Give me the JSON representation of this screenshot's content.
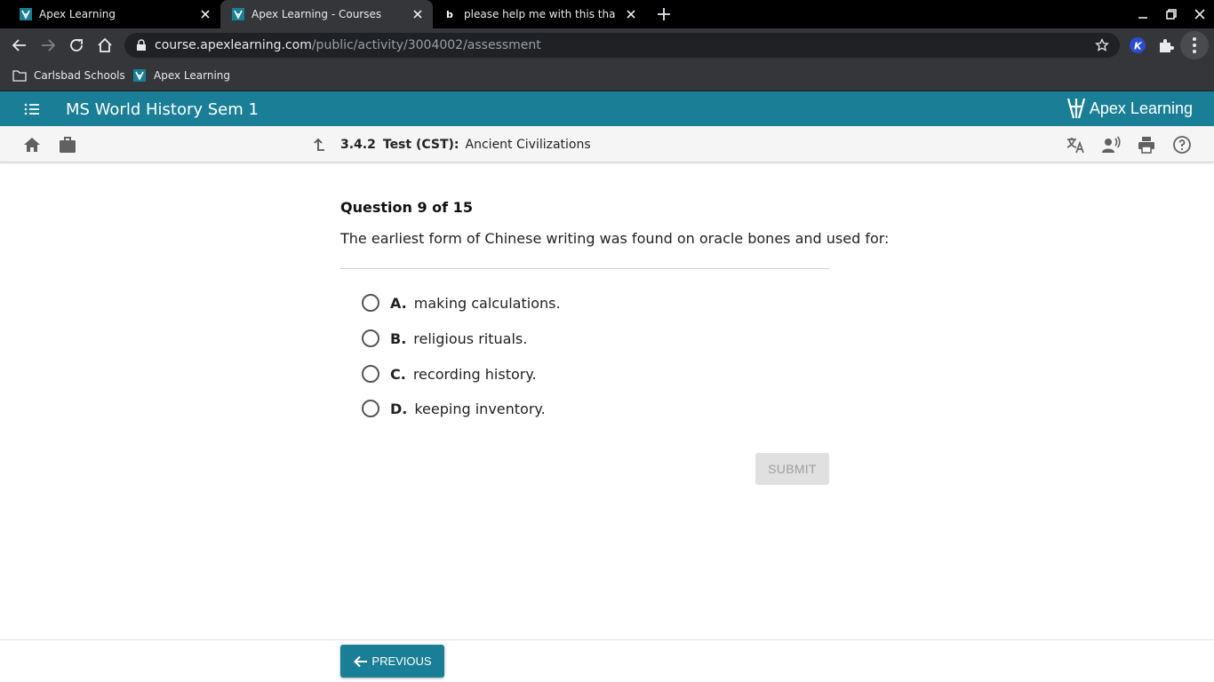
{
  "browser": {
    "tabs": [
      {
        "title": "Apex Learning",
        "active": false
      },
      {
        "title": "Apex Learning - Courses",
        "active": true
      },
      {
        "title": "please help me with this thanks",
        "active": false
      }
    ],
    "url_host": "course.apexlearning.com",
    "url_path": "/public/activity/3004002/assessment",
    "extension_badge": "K",
    "bookmarks": [
      "Carlsbad Schools",
      "Apex Learning"
    ]
  },
  "app": {
    "course_title": "MS World History Sem 1",
    "logo_text": "Apex Learning",
    "brand_color": "#1a7f96"
  },
  "breadcrumb": {
    "number": "3.4.2",
    "kind": "Test (CST):",
    "title": "Ancient Civilizations"
  },
  "question": {
    "heading": "Question 9 of 15",
    "prompt": "The earliest form of Chinese writing was found on oracle bones and used for:",
    "answers": [
      {
        "letter": "A.",
        "text": "making calculations."
      },
      {
        "letter": "B.",
        "text": "religious rituals."
      },
      {
        "letter": "C.",
        "text": "recording history."
      },
      {
        "letter": "D.",
        "text": "keeping inventory."
      }
    ],
    "submit_label": "SUBMIT"
  },
  "footer": {
    "previous_label": "PREVIOUS"
  }
}
